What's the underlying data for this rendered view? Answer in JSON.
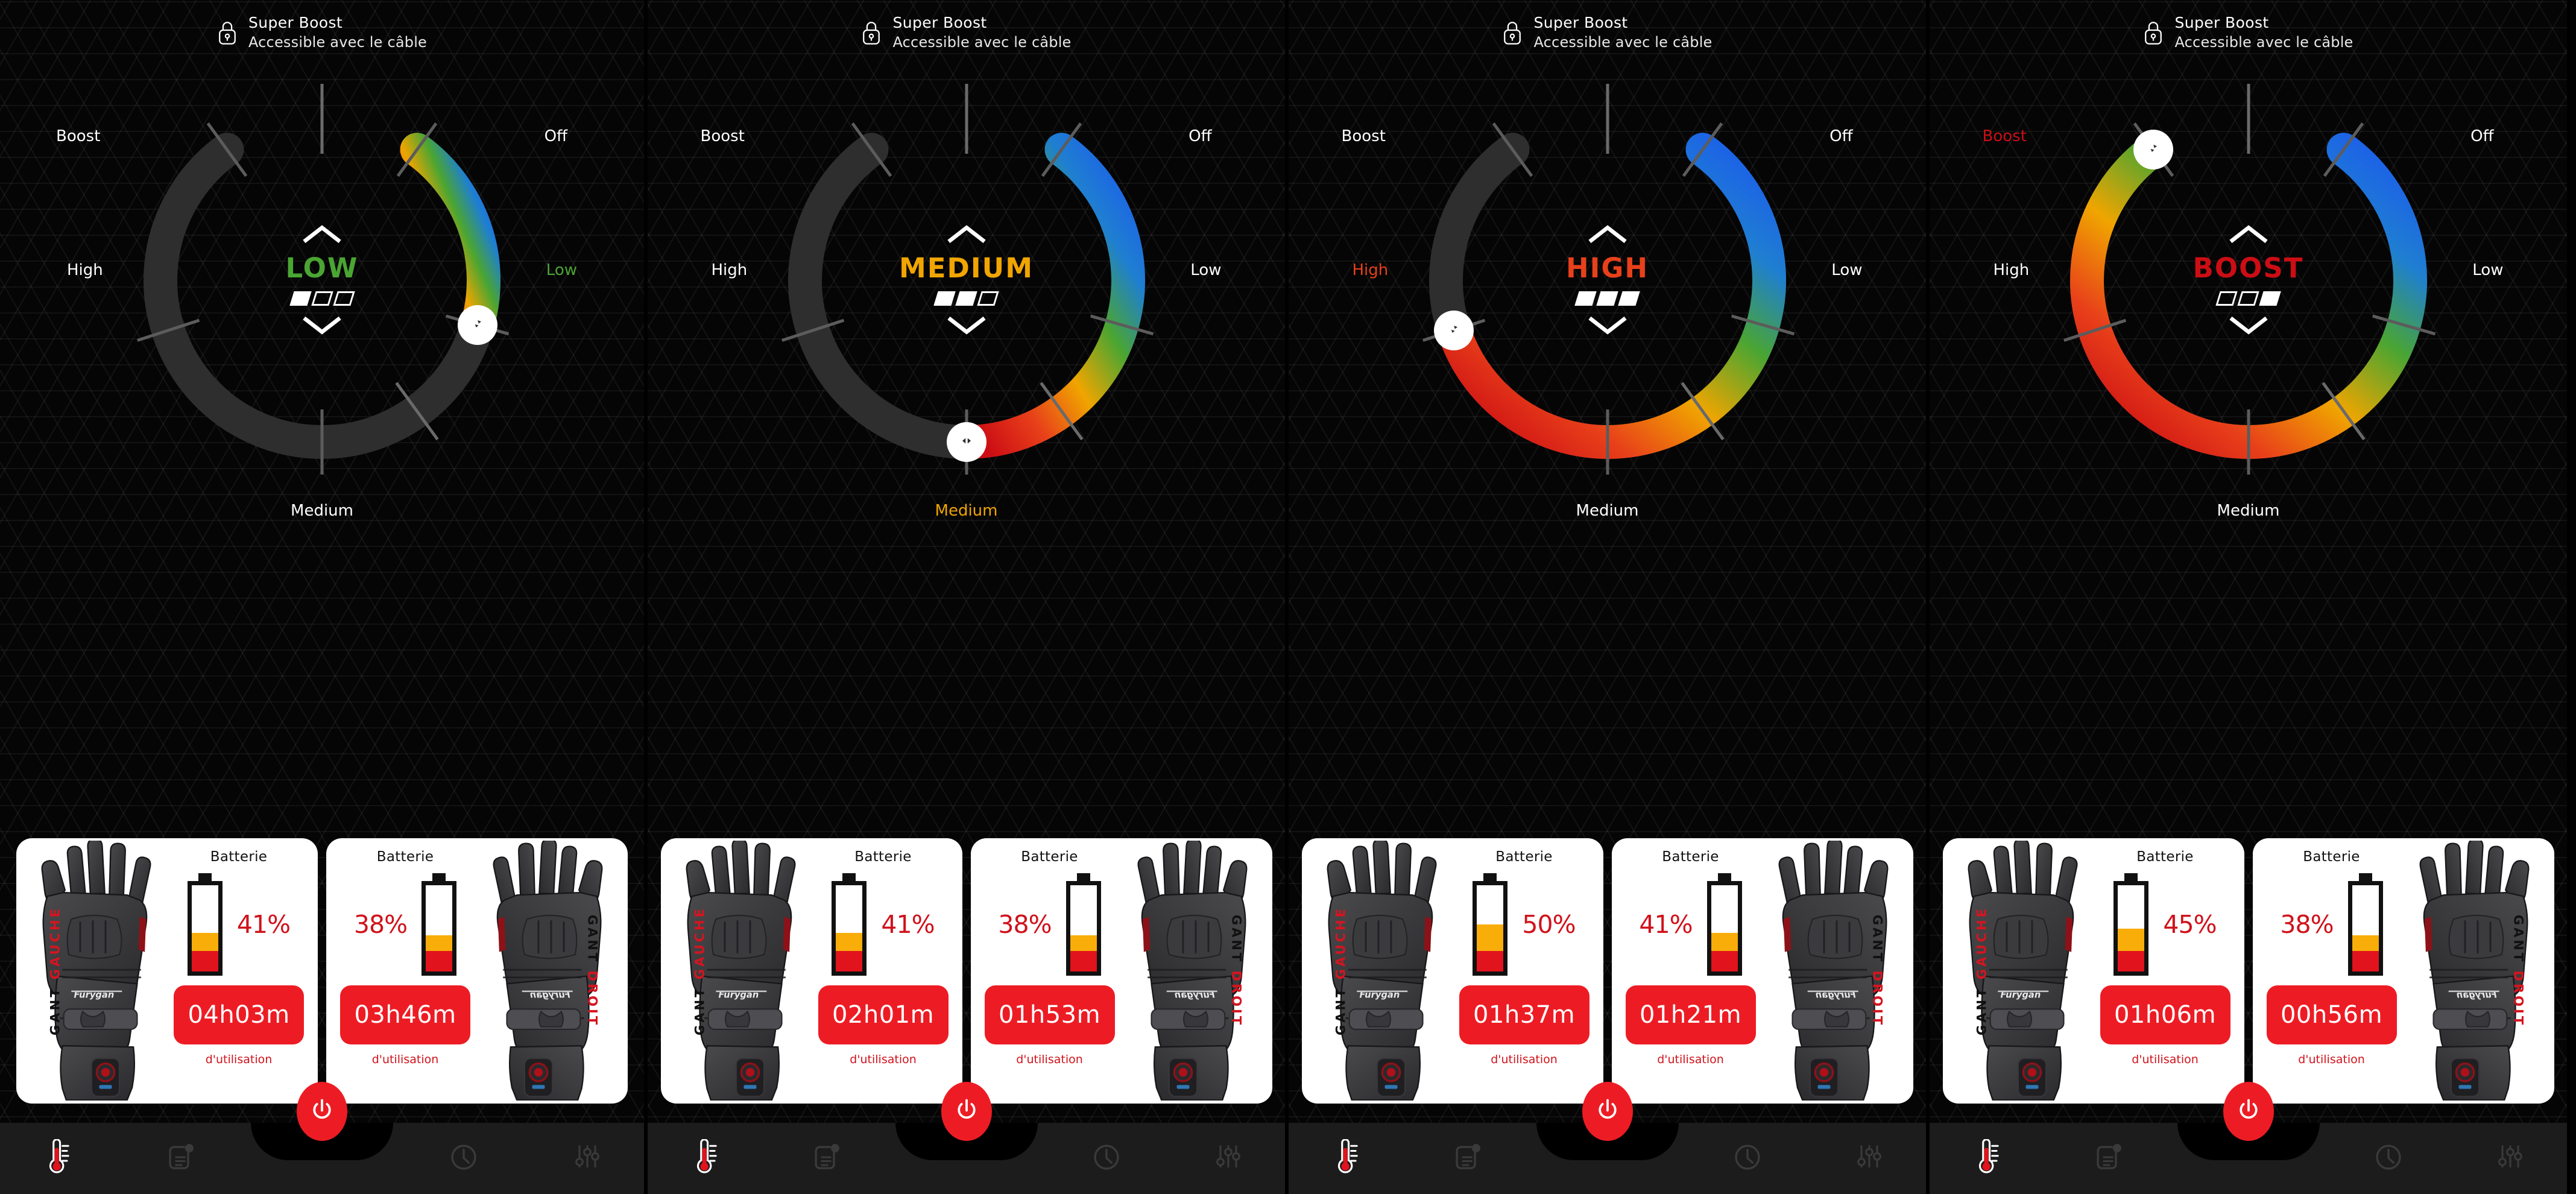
{
  "header": {
    "lock_icon": "lock-icon",
    "title": "Super Boost",
    "subtitle": "Accessible avec le câble"
  },
  "dial": {
    "ticks": {
      "off": "Off",
      "low": "Low",
      "medium": "Medium",
      "high": "High",
      "boost": "Boost"
    },
    "chevron_up_icon": "chevron-up-icon",
    "chevron_down_icon": "chevron-down-icon",
    "knob_icon": "knob-grip-icon"
  },
  "cards": {
    "battery_title": "Batterie",
    "usage_caption": "d'utilisation",
    "left_label_a": "GANT ",
    "left_label_b": "GAUCHE",
    "right_label_a": "GANT ",
    "right_label_b": "DROIT"
  },
  "navbar": {
    "items": [
      {
        "name": "temperature",
        "icon": "thermometer-icon",
        "active": true
      },
      {
        "name": "notes",
        "icon": "notes-icon",
        "active": false
      },
      {
        "name": "timer",
        "icon": "clock-icon",
        "active": false
      },
      {
        "name": "settings",
        "icon": "sliders-icon",
        "active": false
      }
    ],
    "power_icon": "power-icon"
  },
  "colors": {
    "off": "#1b57f0",
    "low": "#4aa532",
    "medium": "#f0a500",
    "high": "#e8401a",
    "boost": "#cc0d14",
    "track": "#2e2e2e",
    "brand_red": "#ed1c24",
    "card_bg": "#ffffff"
  },
  "panels": [
    {
      "id": "panel-low",
      "mode": {
        "label": "LOW",
        "color": "#4aa532",
        "level": 1,
        "blocks": [
          true,
          false,
          false
        ],
        "knob_angle": 106,
        "arc_end_angle": 106,
        "active_tick": "low",
        "knob_icon": "knob-grip-single-icon"
      },
      "gloves": [
        {
          "side": "left",
          "battery_pct": "41%",
          "pct_value": 41,
          "time": "04h03m"
        },
        {
          "side": "right",
          "battery_pct": "38%",
          "pct_value": 38,
          "time": "03h46m"
        }
      ]
    },
    {
      "id": "panel-medium",
      "mode": {
        "label": "MEDIUM",
        "color": "#f0a500",
        "level": 2,
        "blocks": [
          true,
          true,
          false
        ],
        "knob_angle": 180,
        "arc_end_angle": 180,
        "active_tick": "medium",
        "knob_icon": "knob-grip-double-icon"
      },
      "gloves": [
        {
          "side": "left",
          "battery_pct": "41%",
          "pct_value": 41,
          "time": "02h01m"
        },
        {
          "side": "right",
          "battery_pct": "38%",
          "pct_value": 38,
          "time": "01h53m"
        }
      ]
    },
    {
      "id": "panel-high",
      "mode": {
        "label": "HIGH",
        "color": "#e8401a",
        "level": 3,
        "blocks": [
          true,
          true,
          true
        ],
        "knob_angle": 252,
        "arc_end_angle": 252,
        "active_tick": "high",
        "knob_icon": "knob-grip-single-icon"
      },
      "gloves": [
        {
          "side": "left",
          "battery_pct": "50%",
          "pct_value": 50,
          "time": "01h37m"
        },
        {
          "side": "right",
          "battery_pct": "41%",
          "pct_value": 41,
          "time": "01h21m"
        }
      ]
    },
    {
      "id": "panel-boost",
      "mode": {
        "label": "BOOST",
        "color": "#cc0d14",
        "level": 3,
        "blocks": [
          false,
          false,
          true
        ],
        "knob_angle": 324,
        "arc_end_angle": 324,
        "active_tick": "boost",
        "knob_icon": "knob-grip-single-icon"
      },
      "gloves": [
        {
          "side": "left",
          "battery_pct": "45%",
          "pct_value": 45,
          "time": "01h06m"
        },
        {
          "side": "right",
          "battery_pct": "38%",
          "pct_value": 38,
          "time": "00h56m"
        }
      ]
    }
  ]
}
